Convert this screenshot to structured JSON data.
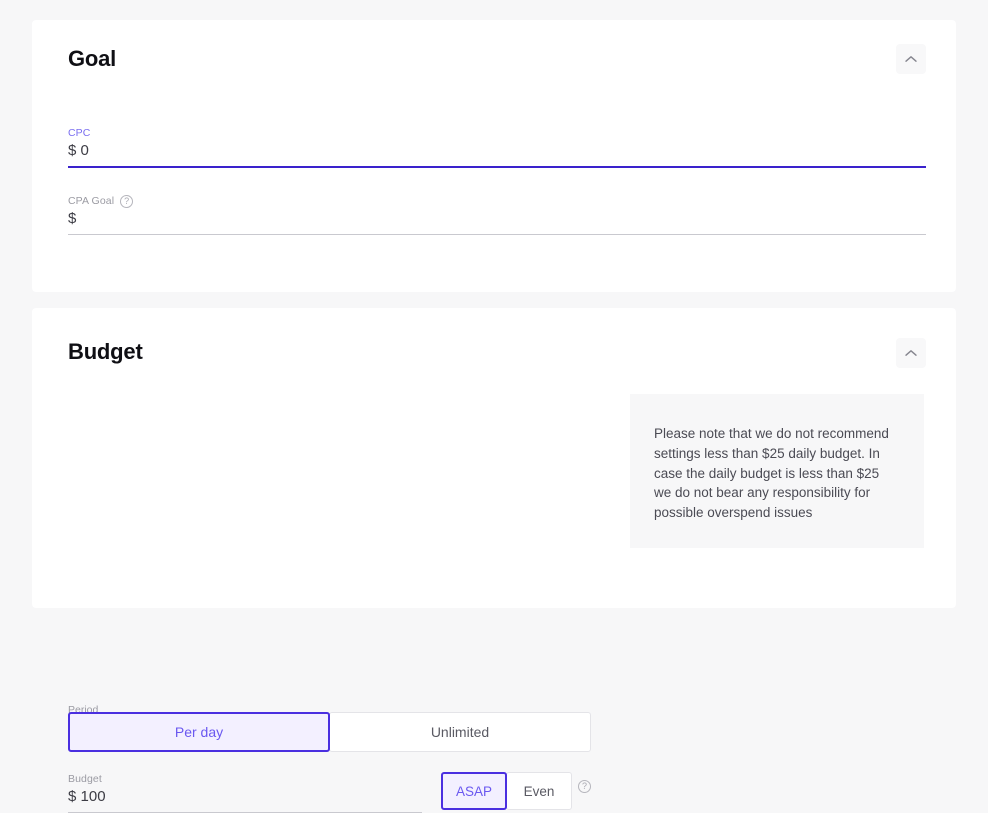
{
  "goal_section": {
    "title": "Goal",
    "collapse_icon": "chevron-up-icon",
    "cpc_field": {
      "label": "CPC",
      "value": "$ 0",
      "focused": true,
      "accent_color": "#3a22cc"
    },
    "cpa_field": {
      "label": "CPA Goal",
      "value": "$",
      "help_icon": "help-circle-icon",
      "help_glyph": "?",
      "focused": false
    }
  },
  "budget_section": {
    "title": "Budget",
    "collapse_icon": "chevron-up-icon",
    "period": {
      "label": "Period",
      "options": [
        "Per day",
        "Unlimited"
      ],
      "selected": "Per day"
    },
    "budget_field": {
      "label": "Budget",
      "value": "$ 100"
    },
    "pacing": {
      "options": [
        "ASAP",
        "Even"
      ],
      "selected": "ASAP",
      "help_icon": "help-circle-icon",
      "help_glyph": "?"
    },
    "notice": {
      "text": "Please note that we do not recommend settings less than $25 daily budget. In case the daily budget is less than $25 we do not bear any responsibility for possible overspend issues"
    }
  },
  "colors": {
    "accent": "#4a2fe0",
    "accent_light": "#6a58f0",
    "accent_bg": "#f3f0ff",
    "page_bg": "#f7f7f8",
    "card_bg": "#ffffff",
    "muted_text": "#9b9ba3"
  }
}
